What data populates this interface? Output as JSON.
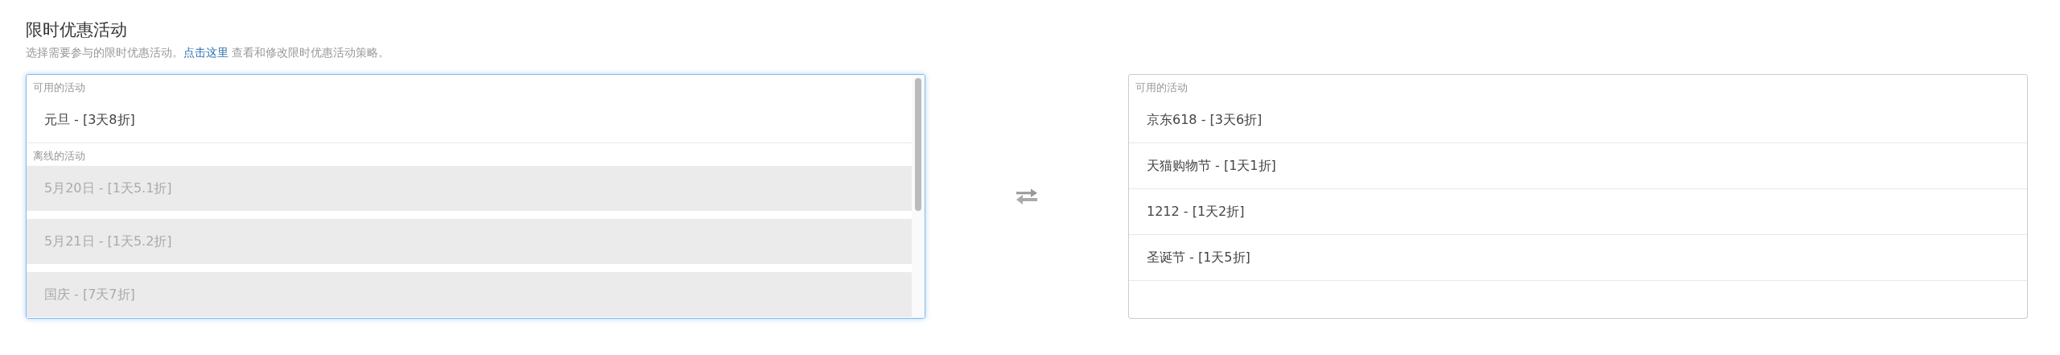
{
  "section": {
    "title": "限时优惠活动",
    "description_before": "选择需要参与的限时优惠活动。",
    "link": "点击这里",
    "description_after": " 查看和修改限时优惠活动策略。"
  },
  "lists": [
    {
      "focused": true,
      "groups": [
        {
          "label": "可用的活动",
          "items": [
            {
              "label": "元旦 - [3天8折]",
              "disabled": false
            }
          ]
        },
        {
          "label": "离线的活动",
          "items": [
            {
              "label": "5月20日 - [1天5.1折]",
              "disabled": true
            },
            {
              "label": "5月21日 - [1天5.2折]",
              "disabled": true
            },
            {
              "label": "国庆 - [7天7折]",
              "disabled": true
            }
          ]
        }
      ]
    },
    {
      "focused": false,
      "groups": [
        {
          "label": "可用的活动",
          "items": [
            {
              "label": "京东618 - [3天6折]",
              "disabled": false
            },
            {
              "label": "天猫购物节 - [1天1折]",
              "disabled": false
            },
            {
              "label": "1212 - [1天2折]",
              "disabled": false
            },
            {
              "label": "圣诞节 - [1天5折]",
              "disabled": false
            }
          ]
        }
      ]
    }
  ]
}
